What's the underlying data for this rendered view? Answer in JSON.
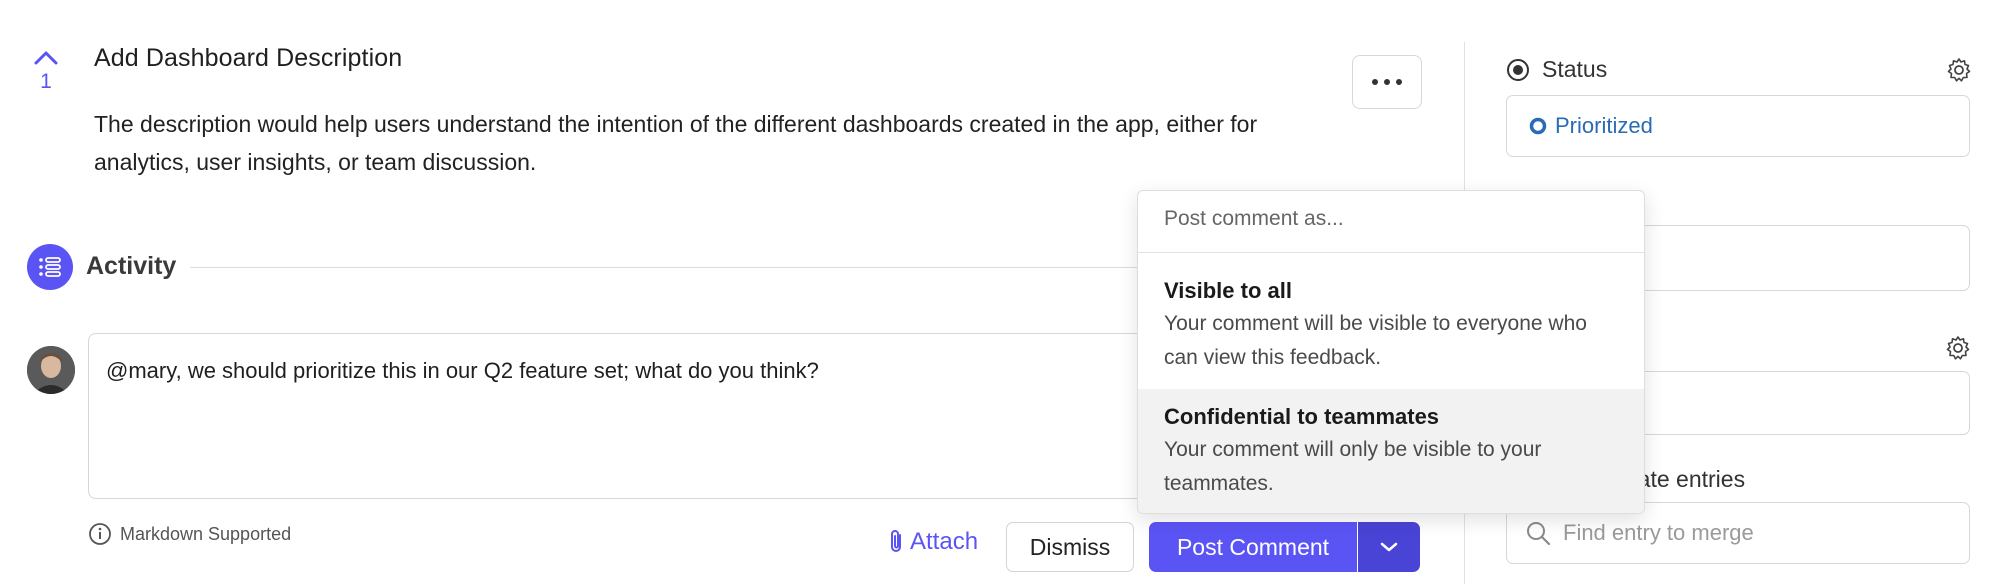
{
  "post": {
    "upvotes": "1",
    "title": "Add Dashboard Description",
    "description": "The description would help users understand the intention of the different dashboards created in the app, either for analytics, user insights, or team discussion."
  },
  "activity": {
    "label": "Activity"
  },
  "comment": {
    "text": "@mary, we should prioritize this in our Q2 feature set; what do you think?",
    "markdown_note": "Markdown Supported",
    "attach_label": "Attach",
    "dismiss_label": "Dismiss",
    "post_label": "Post Comment"
  },
  "post_as_menu": {
    "header": "Post comment as...",
    "options": [
      {
        "title": "Visible to all",
        "description": "Your comment will be visible to everyone who can view this feedback."
      },
      {
        "title": "Confidential to teammates",
        "description": "Your comment will only be visible to your teammates."
      }
    ]
  },
  "sidebar": {
    "status_label": "Status",
    "status_value": "Prioritized",
    "duplicates_label": "Merge duplicate entries",
    "search_placeholder": "Find entry to merge"
  },
  "colors": {
    "accent": "#5b54f5",
    "status_blue": "#2a6bb5"
  }
}
